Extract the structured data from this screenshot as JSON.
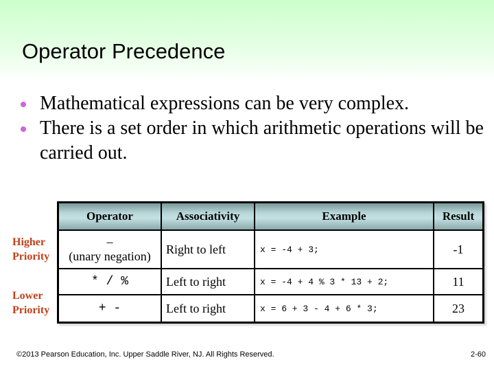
{
  "slide": {
    "title": "Operator Precedence",
    "bullet_color": "#cc66dd",
    "bullets": [
      "Mathematical expressions can be very complex.",
      "There is a set order in which arithmetic operations will be carried out."
    ]
  },
  "priority_labels": {
    "higher_line1": "Higher",
    "higher_line2": "Priority",
    "lower_line1": "Lower",
    "lower_line2": "Priority",
    "color": "#c0401a"
  },
  "table": {
    "headers": [
      "Operator",
      "Associativity",
      "Example",
      "Result"
    ],
    "rows": [
      {
        "operator": "–",
        "operator_note": "(unary negation)",
        "associativity": "Right to left",
        "example": "x = -4 + 3;",
        "result": "-1"
      },
      {
        "operator": "* / %",
        "operator_note": "",
        "associativity": "Left to right",
        "example": "x = -4 + 4 % 3 * 13 + 2;",
        "result": "11"
      },
      {
        "operator": "+ -",
        "operator_note": "",
        "associativity": "Left to right",
        "example": "x = 6 + 3 - 4 + 6 * 3;",
        "result": "23"
      }
    ]
  },
  "footer": {
    "copyright": "©2013 Pearson Education, Inc. Upper Saddle River, NJ. All Rights Reserved.",
    "page_number": "2-60"
  }
}
